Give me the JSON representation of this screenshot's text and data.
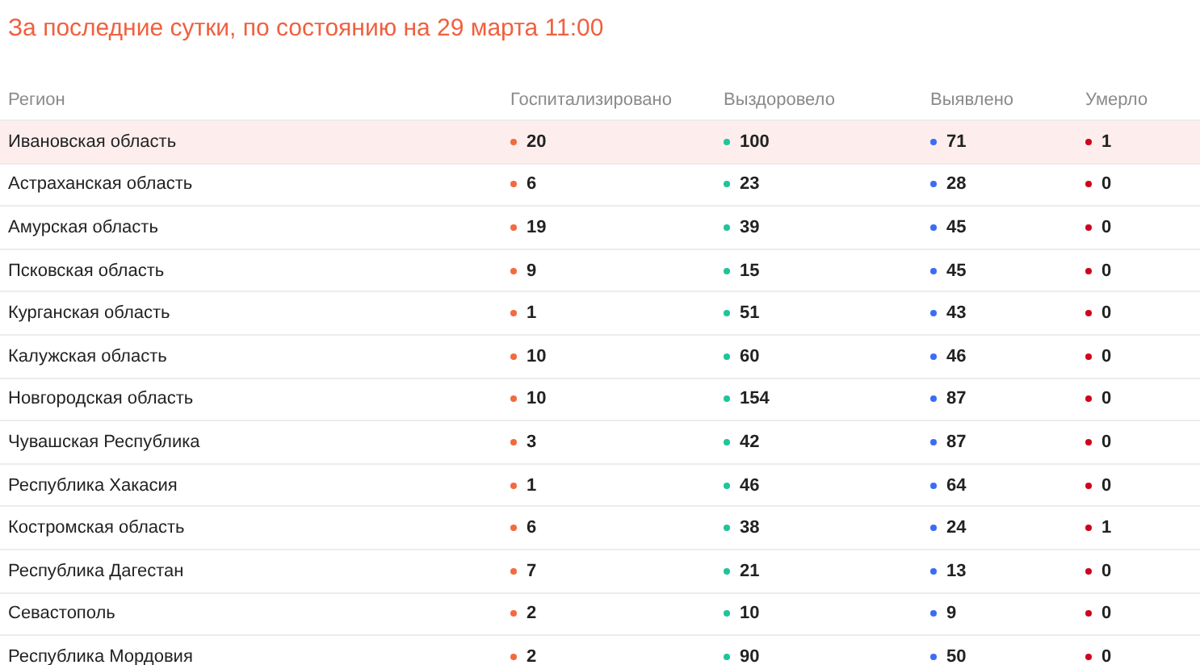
{
  "title": "За последние сутки, по состоянию на 29 марта 11:00",
  "table": {
    "columns": [
      {
        "label": "Регион"
      },
      {
        "label": "Госпитализировано",
        "color": "#f26a3f"
      },
      {
        "label": "Выздоровело",
        "color": "#1fc49a"
      },
      {
        "label": "Выявлено",
        "color": "#3b6cf5"
      },
      {
        "label": "Умерло",
        "color": "#d0021b"
      }
    ],
    "rows": [
      {
        "cells": [
          "Ивановская область",
          "20",
          "100",
          "71",
          "1"
        ],
        "selected": true
      },
      {
        "cells": [
          "Астраханская область",
          "6",
          "23",
          "28",
          "0"
        ],
        "selected": false
      },
      {
        "cells": [
          "Амурская область",
          "19",
          "39",
          "45",
          "0"
        ],
        "selected": false
      },
      {
        "cells": [
          "Псковская область",
          "9",
          "15",
          "45",
          "0"
        ],
        "selected": false
      },
      {
        "cells": [
          "Курганская область",
          "1",
          "51",
          "43",
          "0"
        ],
        "selected": false
      },
      {
        "cells": [
          "Калужская область",
          "10",
          "60",
          "46",
          "0"
        ],
        "selected": false
      },
      {
        "cells": [
          "Новгородская область",
          "10",
          "154",
          "87",
          "0"
        ],
        "selected": false
      },
      {
        "cells": [
          "Чувашская Республика",
          "3",
          "42",
          "87",
          "0"
        ],
        "selected": false
      },
      {
        "cells": [
          "Республика Хакасия",
          "1",
          "46",
          "64",
          "0"
        ],
        "selected": false
      },
      {
        "cells": [
          "Костромская область",
          "6",
          "38",
          "24",
          "1"
        ],
        "selected": false
      },
      {
        "cells": [
          "Республика Дагестан",
          "7",
          "21",
          "13",
          "0"
        ],
        "selected": false
      },
      {
        "cells": [
          "Севастополь",
          "2",
          "10",
          "9",
          "0"
        ],
        "selected": false
      },
      {
        "cells": [
          "Республика Мордовия",
          "2",
          "90",
          "50",
          "0"
        ],
        "selected": false
      }
    ]
  }
}
